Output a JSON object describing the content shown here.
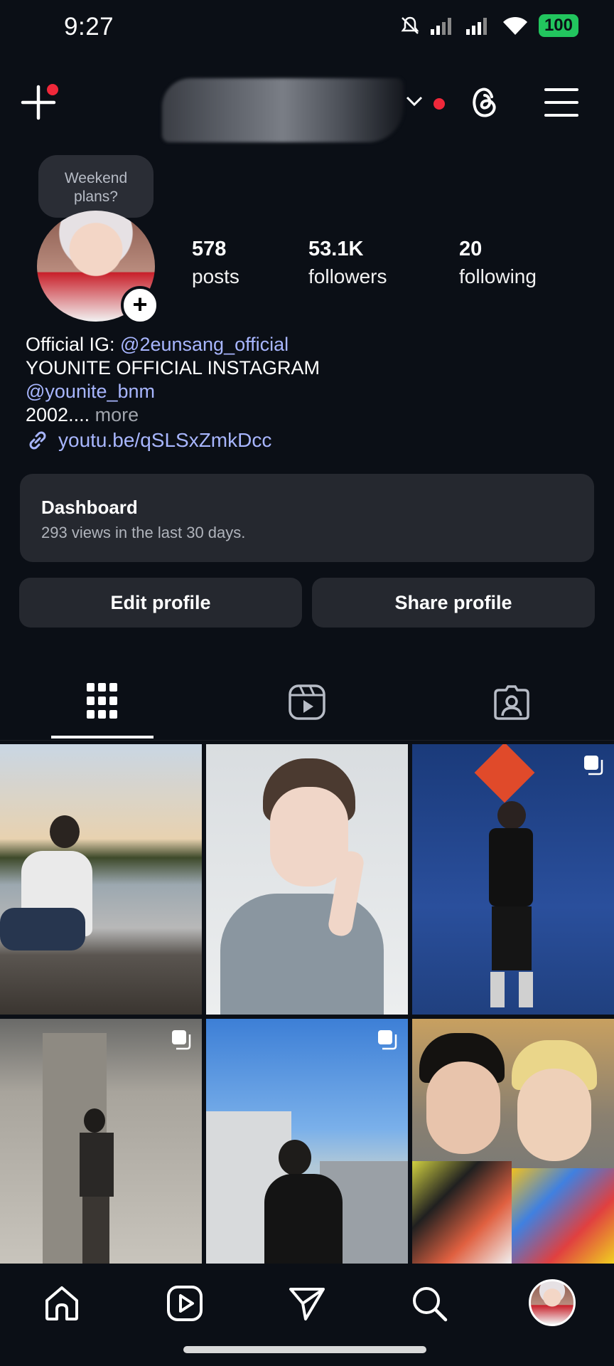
{
  "status_bar": {
    "time": "9:27",
    "battery": "100"
  },
  "header": {
    "username_redacted": true
  },
  "note": {
    "text_line1": "Weekend",
    "text_line2": "plans?"
  },
  "stats": [
    {
      "value": "578",
      "label": "posts"
    },
    {
      "value": "53.1K",
      "label": "followers"
    },
    {
      "value": "20",
      "label": "following"
    }
  ],
  "bio": {
    "line1_prefix": "Official IG: ",
    "line1_mention": "@2eunsang_official",
    "line2": "YOUNITE OFFICIAL INSTAGRAM",
    "line3_mention": "@younite_bnm",
    "line4_text": "2002....",
    "line4_more": " more",
    "link": "youtu.be/qSLSxZmkDcc"
  },
  "dashboard": {
    "title": "Dashboard",
    "subtitle": "293 views in the last 30 days."
  },
  "buttons": {
    "edit": "Edit profile",
    "share": "Share profile"
  },
  "tabs": [
    "grid-icon",
    "reels-icon",
    "tagged-icon"
  ],
  "grid": {
    "posts": [
      {
        "name": "post-sunset-lake",
        "multi": false
      },
      {
        "name": "post-peace-sign",
        "multi": false
      },
      {
        "name": "post-pinwheel",
        "multi": true
      },
      {
        "name": "post-concrete-pillar",
        "multi": true
      },
      {
        "name": "post-city-view",
        "multi": true
      },
      {
        "name": "post-duo-selfie",
        "multi": false
      }
    ]
  },
  "colors": {
    "background": "#0b0f16",
    "card": "#25282f",
    "link": "#a8b6ff",
    "notification": "#f0283a",
    "battery": "#22c55e"
  }
}
